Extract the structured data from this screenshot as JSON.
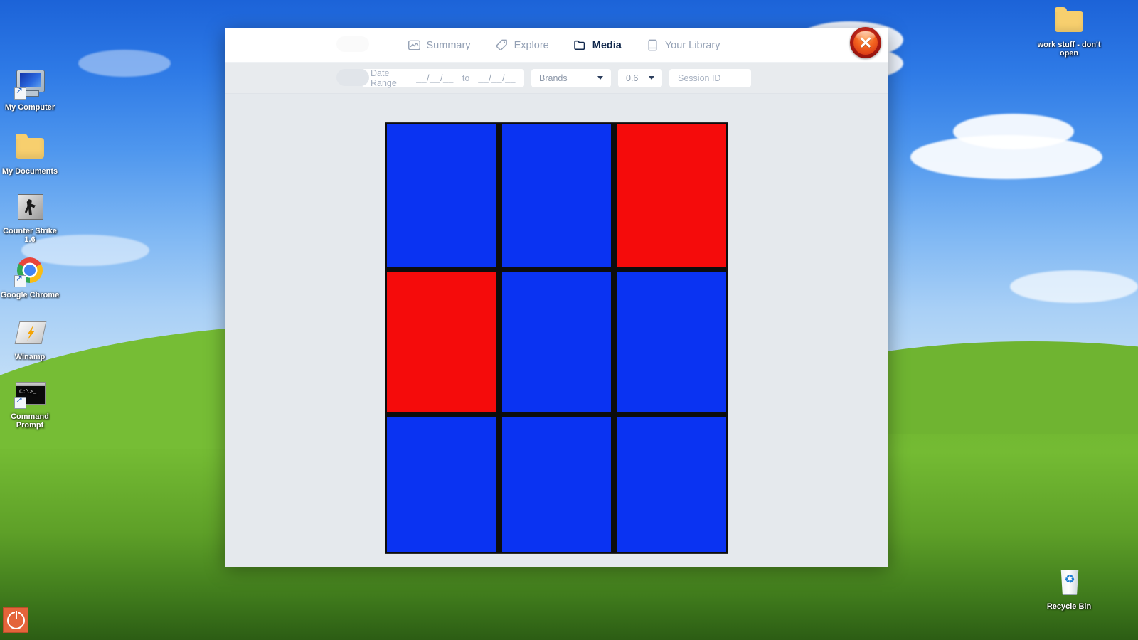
{
  "desktop": {
    "left_icons": [
      {
        "label": "My Computer",
        "icon": "computer-icon",
        "shortcut": true
      },
      {
        "label": "My Documents",
        "icon": "folder-icon",
        "shortcut": false
      },
      {
        "label": "Counter Strike 1.6",
        "icon": "counter-strike-icon",
        "shortcut": false
      },
      {
        "label": "Google Chrome",
        "icon": "chrome-icon",
        "shortcut": true
      },
      {
        "label": "Winamp",
        "icon": "winamp-icon",
        "shortcut": false
      },
      {
        "label": "Command Prompt",
        "icon": "command-prompt-icon",
        "shortcut": true
      }
    ],
    "right_icons": [
      {
        "label": "work stuff - don't open",
        "icon": "folder-icon",
        "shortcut": false
      },
      {
        "label": "Recycle Bin",
        "icon": "recycle-bin-icon",
        "shortcut": false
      }
    ],
    "taskbar": {
      "power_button": "power-icon"
    }
  },
  "modal": {
    "close_label": "✕",
    "tabs": [
      {
        "label": "Summary",
        "icon": "chart-icon",
        "active": false
      },
      {
        "label": "Explore",
        "icon": "tag-icon",
        "active": false
      },
      {
        "label": "Media",
        "icon": "folder-icon",
        "active": true
      },
      {
        "label": "Your Library",
        "icon": "book-icon",
        "active": false
      }
    ],
    "filters": {
      "date_range": {
        "label": "Date Range",
        "from_value": "__/__/__",
        "separator": "to",
        "to_value": "__/__/__"
      },
      "brands_select": {
        "value": "Brands",
        "caret": "chevron-down-icon"
      },
      "threshold_select": {
        "value": "0.6",
        "caret": "chevron-down-icon"
      },
      "session_id": {
        "placeholder": "Session ID",
        "value": ""
      }
    },
    "media": {
      "colors": {
        "blue": "#0a33f2",
        "red": "#f50b0b",
        "grid_line": "#0d0d0d"
      },
      "grid": [
        [
          "blue",
          "blue",
          "red"
        ],
        [
          "red",
          "blue",
          "blue"
        ],
        [
          "blue",
          "blue",
          "blue"
        ]
      ]
    }
  }
}
